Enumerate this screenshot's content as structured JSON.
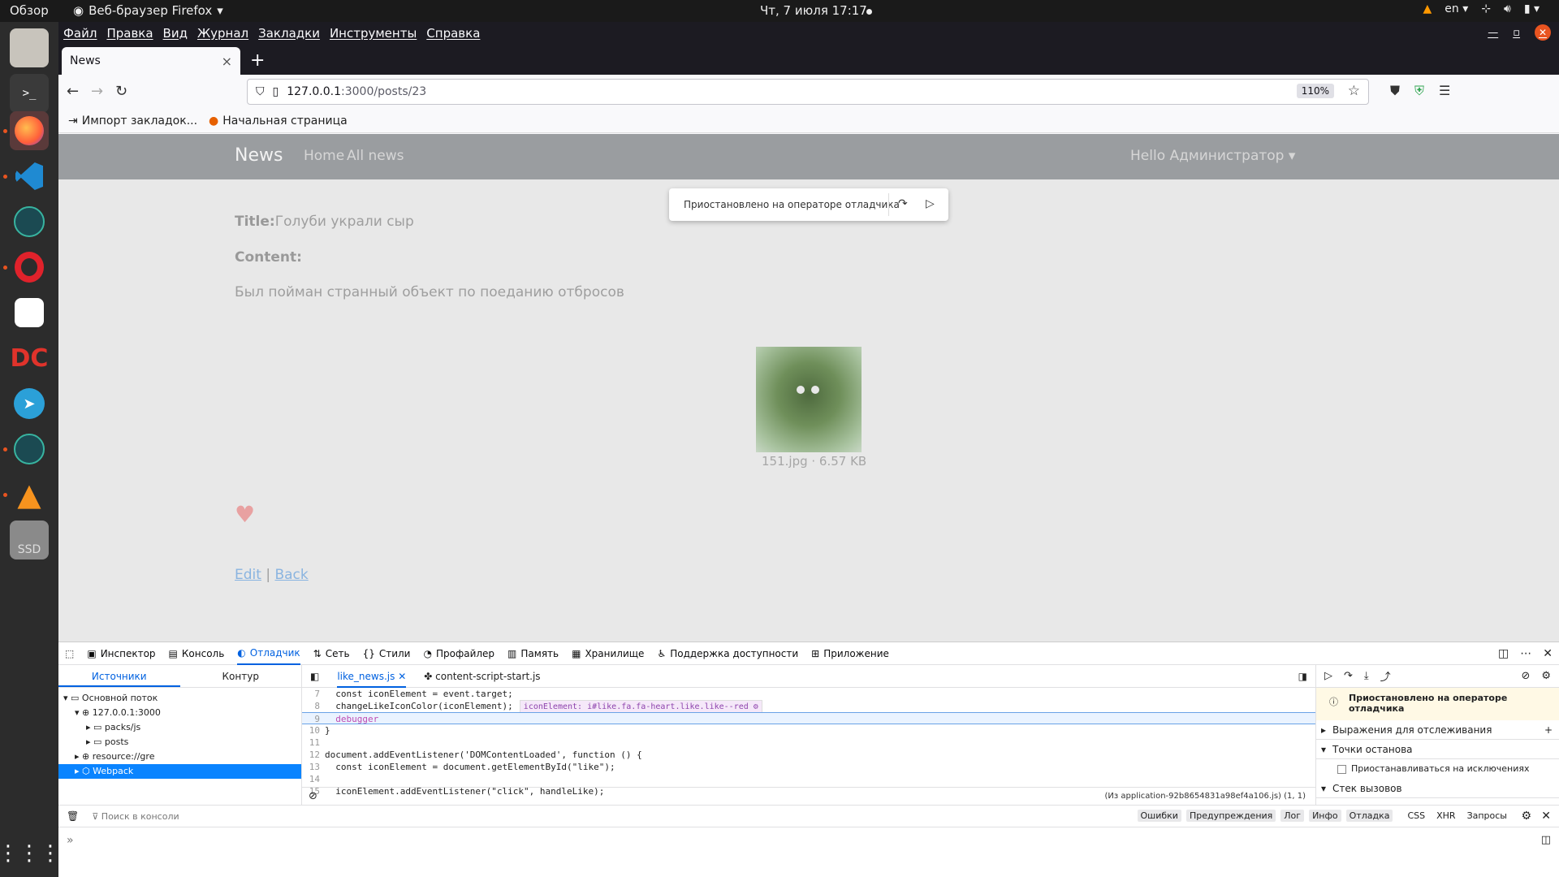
{
  "topbar": {
    "overview": "Обзор",
    "app_name": "Веб-браузер Firefox",
    "clock": "Чт, 7 июля  17:17",
    "lang": "en"
  },
  "menubar": {
    "items": [
      "Файл",
      "Правка",
      "Вид",
      "Журнал",
      "Закладки",
      "Инструменты",
      "Справка"
    ]
  },
  "tab": {
    "title": "News",
    "close": "×",
    "new": "+"
  },
  "urlbar": {
    "host": "127.0.0.1",
    "path": ":3000/posts/23",
    "zoom": "110%"
  },
  "bookmarks": {
    "items": [
      "Импорт закладок...",
      "Начальная страница"
    ]
  },
  "site": {
    "brand": "News",
    "nav": [
      "Home",
      "All news"
    ],
    "user_menu": "Hello Администратор",
    "pause_bubble": "Приостановлено на операторе отладчика",
    "title_label": "Title:",
    "title_value": "Голуби украли сыр",
    "content_label": "Content:",
    "body": "Был пойман странный объект по поеданию отбросов",
    "image_caption": "151.jpg · 6.57 KB",
    "links": {
      "edit": "Edit",
      "sep": " | ",
      "back": "Back"
    }
  },
  "devtools": {
    "tabs": [
      "Инспектор",
      "Консоль",
      "Отладчик",
      "Сеть",
      "Стили",
      "Профайлер",
      "Память",
      "Хранилище",
      "Поддержка доступности",
      "Приложение"
    ],
    "active_tab": "Отладчик",
    "sources_tabs": [
      "Источники",
      "Контур"
    ],
    "tree": [
      {
        "label": "Основной поток",
        "depth": 0
      },
      {
        "label": "127.0.0.1:3000",
        "depth": 1
      },
      {
        "label": "packs/js",
        "depth": 2
      },
      {
        "label": "posts",
        "depth": 2
      },
      {
        "label": "resource://gre",
        "depth": 1
      },
      {
        "label": "Webpack",
        "depth": 1,
        "selected": true
      }
    ],
    "editor_tabs": [
      "like_news.js",
      "content-script-start.js"
    ],
    "code": [
      {
        "n": "7",
        "text": "  const iconElement = event.target;"
      },
      {
        "n": "8",
        "text": "  changeLikeIconColor(iconElement);",
        "preview_label": "iconElement:",
        "preview_value": "i#like.fa.fa-heart.like.like--red"
      },
      {
        "n": "9",
        "text": "  debugger",
        "paused": true
      },
      {
        "n": "10",
        "text": "}"
      },
      {
        "n": "11",
        "text": ""
      },
      {
        "n": "12",
        "text": "document.addEventListener('DOMContentLoaded', function () {"
      },
      {
        "n": "13",
        "text": "  const iconElement = document.getElementById(\"like\");"
      },
      {
        "n": "14",
        "text": ""
      },
      {
        "n": "15",
        "text": "  iconElement.addEventListener(\"click\", handleLike);"
      }
    ],
    "source_footer": "(Из application-92b8654831a98ef4a106.js)  (1, 1)",
    "right_panel": {
      "paused": "Приостановлено на операторе отладчика",
      "watch": "Выражения для отслеживания",
      "breakpoints": "Точки останова",
      "pause_on_exceptions": "Приостанавливаться на исключениях",
      "call_stack": "Стек вызовов"
    },
    "console": {
      "filter_placeholder": "Поиск в консоли",
      "levels": [
        "Ошибки",
        "Предупреждения",
        "Лог",
        "Инфо",
        "Отладка"
      ],
      "extra": [
        "CSS",
        "XHR",
        "Запросы"
      ],
      "prompt": "»"
    }
  }
}
